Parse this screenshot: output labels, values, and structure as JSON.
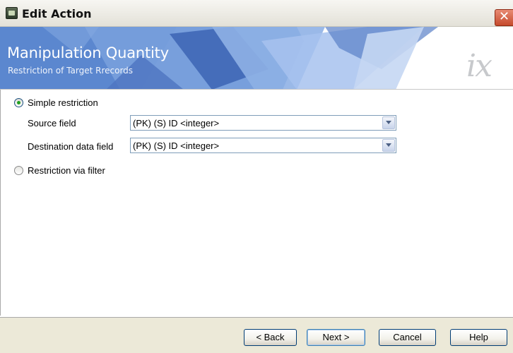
{
  "window": {
    "title": "Edit Action",
    "close_glyph": "✕"
  },
  "banner": {
    "title": "Manipulation Quantity",
    "subtitle": "Restriction of Target Rrecords",
    "logo": "ix",
    "colors": {
      "primary": "#5b87cf",
      "secondary": "#8fb1e6",
      "accent": "#3f67b6"
    }
  },
  "form": {
    "simple_restriction": {
      "label": "Simple restriction",
      "checked": true
    },
    "source_field": {
      "label": "Source field",
      "value": "(PK) (S) ID <integer>"
    },
    "destination_field": {
      "label": "Destination data field",
      "value": "(PK) (S) ID <integer>"
    },
    "restriction_via_filter": {
      "label": "Restriction via filter",
      "checked": false
    }
  },
  "buttons": {
    "back": "< Back",
    "next": "Next >",
    "cancel": "Cancel",
    "help": "Help"
  }
}
